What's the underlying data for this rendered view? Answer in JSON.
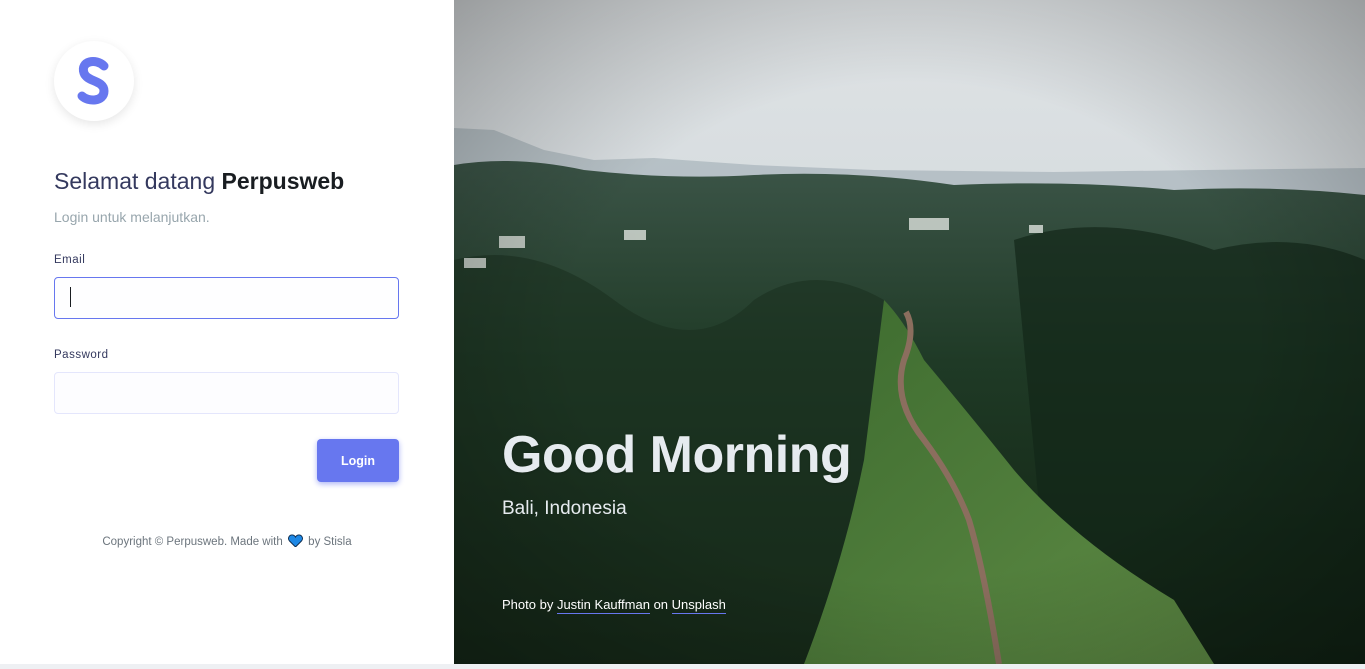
{
  "login": {
    "logo_icon": "stisla-s-logo",
    "welcome_prefix": "Selamat datang",
    "brand": "Perpusweb",
    "subtitle": "Login untuk melanjutkan.",
    "email_label": "Email",
    "email_value": "",
    "password_label": "Password",
    "password_value": "",
    "login_button": "Login",
    "copyright_before": "Copyright © Perpusweb. Made with",
    "copyright_after": "by Stisla",
    "heart_icon": "heart-icon"
  },
  "hero": {
    "greeting": "Good Morning",
    "location": "Bali, Indonesia",
    "credit_prefix": "Photo by",
    "photographer": "Justin Kauffman",
    "credit_mid": "on",
    "source": "Unsplash"
  },
  "colors": {
    "primary": "#6777ef",
    "heading": "#191d21",
    "muted": "#98a6ad"
  }
}
